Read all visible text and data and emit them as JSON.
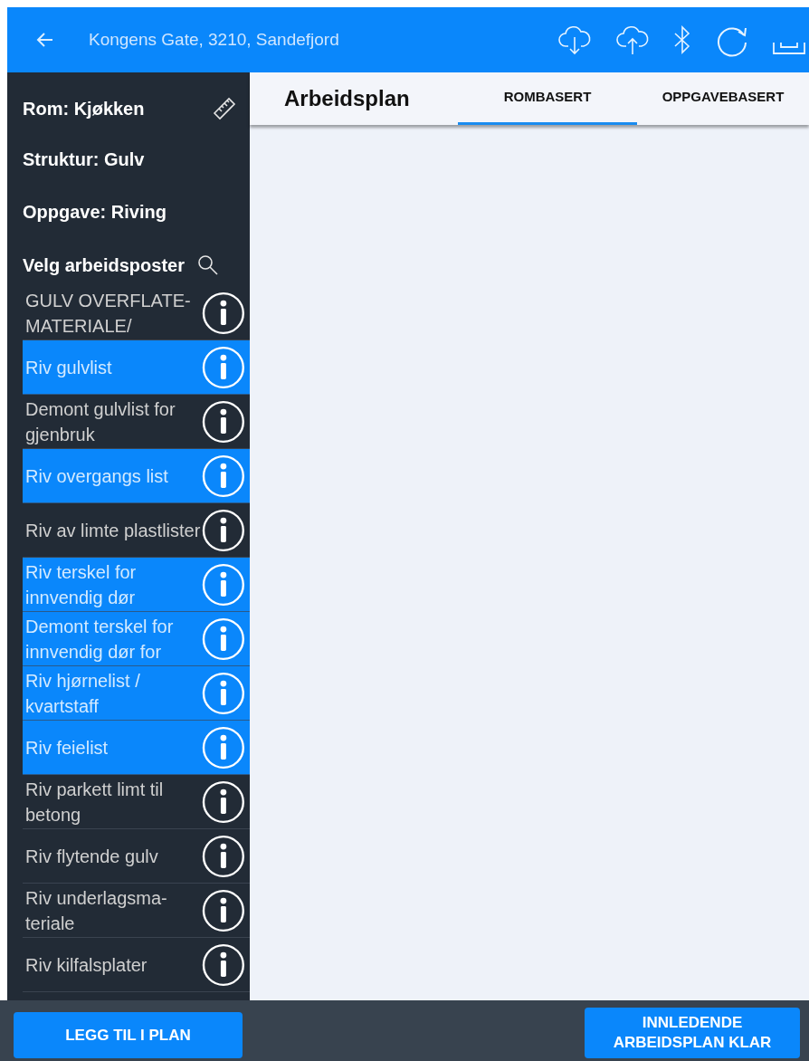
{
  "header": {
    "address": "Kongens Gate, 3210, Sandefjord"
  },
  "sidebar": {
    "room": "Rom: Kjøkken",
    "structure": "Struktur: Gulv",
    "task": "Oppgave: Riving",
    "choose_label": "Velg arbeidsposter",
    "items": [
      {
        "label": "GULV OVERFLATE-MATERIALE/",
        "selected": false
      },
      {
        "label": "Riv gulvlist",
        "selected": true
      },
      {
        "label": "Demont gulvlist for gjenbruk",
        "selected": false
      },
      {
        "label": "Riv overgangs list",
        "selected": true
      },
      {
        "label": "Riv av limte plastlister",
        "selected": false
      },
      {
        "label": "Riv terskel for innvendig dør",
        "selected": true
      },
      {
        "label": "Demont terskel for innvendig dør for",
        "selected": true
      },
      {
        "label": "Riv hjørnelist / kvartstaff",
        "selected": true
      },
      {
        "label": "Riv feielist",
        "selected": true
      },
      {
        "label": "Riv parkett limt til betong",
        "selected": false
      },
      {
        "label": "Riv flytende gulv",
        "selected": false
      },
      {
        "label": "Riv underlagsma-teriale",
        "selected": false
      },
      {
        "label": "Riv kilfalsplater",
        "selected": false
      }
    ]
  },
  "main": {
    "title": "Arbeidsplan",
    "tabs": [
      {
        "label": "ROMBASERT",
        "selected": true
      },
      {
        "label": "OPPGAVEBASERT",
        "selected": false
      }
    ]
  },
  "footer": {
    "add_button": "LEGG TIL I PLAN",
    "done_button": "INNLEDENDE ARBEIDSPLAN KLAR"
  }
}
